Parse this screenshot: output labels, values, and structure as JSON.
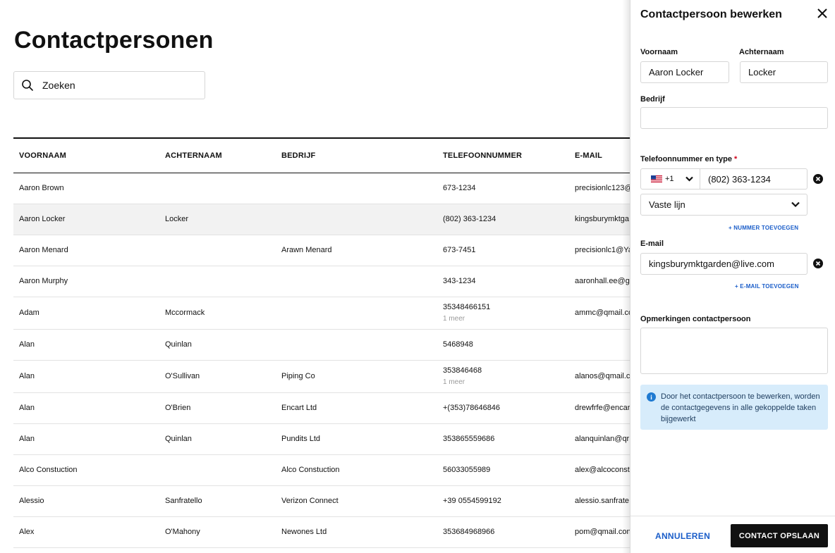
{
  "page": {
    "title": "Contactpersonen"
  },
  "search": {
    "placeholder": "Zoeken"
  },
  "table": {
    "headers": [
      "VOORNAAM",
      "ACHTERNAAM",
      "BEDRIJF",
      "TELEFOONNUMMER",
      "E-MAIL"
    ],
    "rows": [
      {
        "first": "Aaron Brown",
        "last": "",
        "company": "",
        "phone": "673-1234",
        "phone_more": "",
        "email": "precisionlc123@"
      },
      {
        "first": "Aaron Locker",
        "last": "Locker",
        "company": "",
        "phone": "(802) 363-1234",
        "phone_more": "",
        "email": "kingsburymktga"
      },
      {
        "first": "Aaron Menard",
        "last": "",
        "company": "Arawn Menard",
        "phone": "673-7451",
        "phone_more": "",
        "email": "precisionlc1@Ya"
      },
      {
        "first": "Aaron Murphy",
        "last": "",
        "company": "",
        "phone": "343-1234",
        "phone_more": "",
        "email": "aaronhall.ee@g"
      },
      {
        "first": "Adam",
        "last": "Mccormack",
        "company": "",
        "phone": "35348466151",
        "phone_more": "1 meer",
        "email": "ammc@qmail.co"
      },
      {
        "first": "Alan",
        "last": "Quinlan",
        "company": "",
        "phone": "5468948",
        "phone_more": "",
        "email": ""
      },
      {
        "first": "Alan",
        "last": "O'Sullivan",
        "company": "Piping Co",
        "phone": "353846468",
        "phone_more": "1 meer",
        "email": "alanos@qmail.c"
      },
      {
        "first": "Alan",
        "last": "O'Brien",
        "company": "Encart Ltd",
        "phone": "+(353)78646846",
        "phone_more": "",
        "email": "drewfrfe@encar"
      },
      {
        "first": "Alan",
        "last": "Quinlan",
        "company": "Pundits Ltd",
        "phone": "353865559686",
        "phone_more": "",
        "email": "alanquinlan@qr"
      },
      {
        "first": "Alco Constuction",
        "last": "",
        "company": "Alco Constuction",
        "phone": "56033055989",
        "phone_more": "",
        "email": "alex@alcoconst"
      },
      {
        "first": "Alessio",
        "last": "Sanfratello",
        "company": "Verizon Connect",
        "phone": "+39 0554599192",
        "phone_more": "",
        "email": "alessio.sanfrate"
      },
      {
        "first": "Alex",
        "last": "O'Mahony",
        "company": "Newones Ltd",
        "phone": "353684968966",
        "phone_more": "",
        "email": "pom@qmail.con"
      }
    ]
  },
  "panel": {
    "title": "Contactpersoon bewerken",
    "first_name_label": "Voornaam",
    "first_name_value": "Aaron Locker",
    "last_name_label": "Achternaam",
    "last_name_value": "Locker",
    "company_label": "Bedrijf",
    "company_value": "",
    "phone_label": "Telefoonnummer en type",
    "required_mark": "*",
    "country_code": "+1",
    "phone_value": "(802) 363-1234",
    "phone_type": "Vaste lijn",
    "add_phone": "+ NUMMER TOEVOEGEN",
    "email_label": "E-mail",
    "email_value": "kingsburymktgarden@live.com",
    "add_email": "+ E-MAIL TOEVOEGEN",
    "notes_label": "Opmerkingen contactpersoon",
    "info_text": "Door het contactpersoon te bewerken, worden de contactgegevens in alle gekoppelde taken bijgewerkt",
    "cancel_label": "ANNULEREN",
    "save_label": "CONTACT OPSLAAN"
  }
}
